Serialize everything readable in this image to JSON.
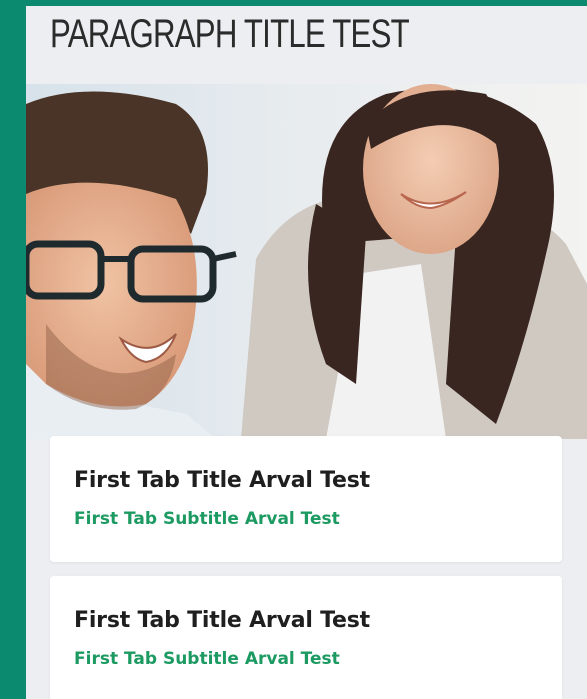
{
  "page": {
    "title": "PARAGRAPH TITLE TEST"
  },
  "hero": {
    "image_icon": "people-photo"
  },
  "cards": [
    {
      "title": "First Tab Title Arval Test",
      "subtitle": "First Tab Subtitle Arval Test"
    },
    {
      "title": "First Tab Title Arval Test",
      "subtitle": "First Tab Subtitle Arval Test"
    }
  ],
  "colors": {
    "frame": "#0b8a6f",
    "background": "#eceef1",
    "card": "#ffffff",
    "title": "#2b2b2b",
    "card_title": "#1f1f1f",
    "subtitle": "#1c9a62"
  }
}
